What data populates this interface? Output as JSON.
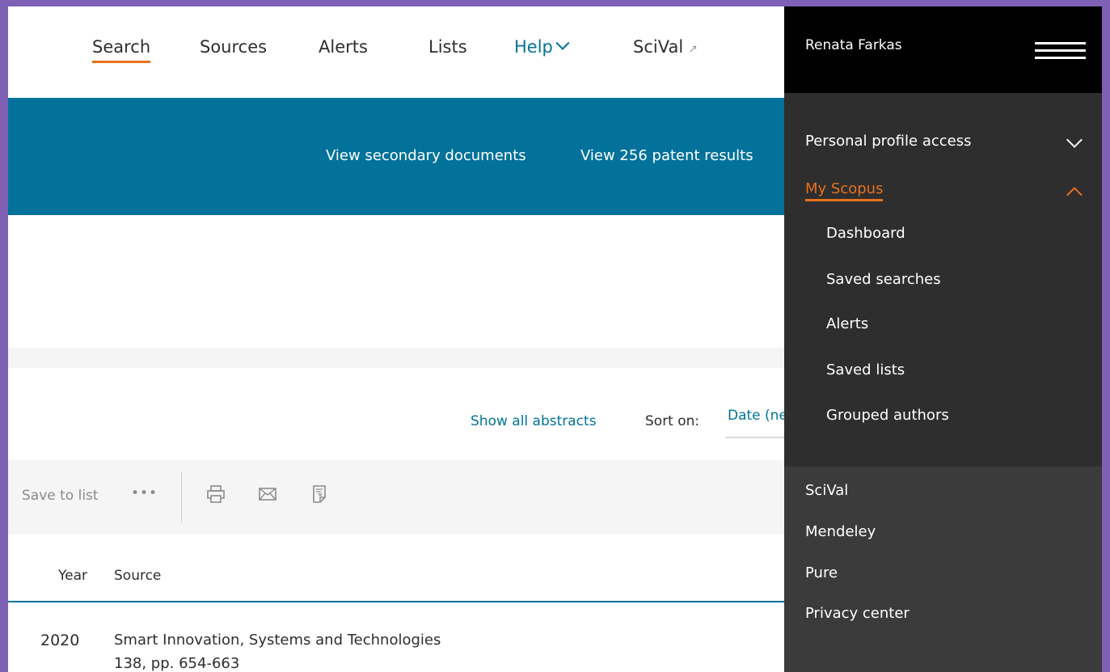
{
  "nav": {
    "items": [
      {
        "label": "Search"
      },
      {
        "label": "Sources"
      },
      {
        "label": "Alerts"
      },
      {
        "label": "Lists"
      },
      {
        "label": "Help"
      },
      {
        "label": "SciVal"
      }
    ],
    "external_arrow": "↗"
  },
  "banner": {
    "secondary_docs": "View secondary documents",
    "patents": "View 256 patent results"
  },
  "results": {
    "show_abstracts": "Show all abstracts",
    "sort_label": "Sort on:",
    "sort_value": "Date (newest)"
  },
  "toolbar": {
    "save_to_list": "Save to list",
    "more": "•••",
    "icons": [
      "print-icon",
      "email-icon",
      "export-icon"
    ]
  },
  "table": {
    "headers": {
      "year": "Year",
      "source": "Source"
    },
    "rows": [
      {
        "year": "2020",
        "source": "Smart Innovation, Systems and Technologies",
        "details": "138, pp. 654-663"
      }
    ]
  },
  "panel": {
    "user": "Renata Farkas",
    "personal_profile": "Personal profile access",
    "my_scopus": "My Scopus",
    "my_scopus_items": [
      {
        "label": "Dashboard"
      },
      {
        "label": "Saved searches"
      },
      {
        "label": "Alerts"
      },
      {
        "label": "Saved lists"
      },
      {
        "label": "Grouped authors"
      }
    ],
    "other_items": [
      {
        "label": "SciVal"
      },
      {
        "label": "Mendeley"
      },
      {
        "label": "Pure"
      },
      {
        "label": "Privacy center"
      }
    ]
  },
  "colors": {
    "accent_orange": "#e9711c",
    "brand_blue": "#03729b",
    "frame_purple": "#7e60b4"
  }
}
